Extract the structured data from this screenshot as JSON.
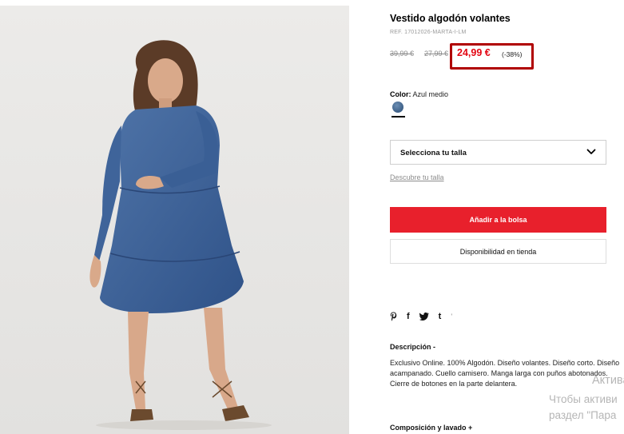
{
  "product": {
    "title": "Vestido algodón volantes",
    "ref": "REF. 17012026-MARTA-I-LM",
    "price_original": "39,99 €",
    "price_previous": "27,99 €",
    "price_current": "24,99 €",
    "discount": "(-38%)"
  },
  "color": {
    "label": "Color:",
    "value": "Azul medio",
    "swatch_color": "#4a6d96"
  },
  "size": {
    "select_label": "Selecciona tu talla",
    "guide_link": "Descubre tu talla"
  },
  "actions": {
    "add_to_bag": "Añadir a la bolsa",
    "store_availability": "Disponibilidad en tienda",
    "add_color": "#e8202c"
  },
  "social": {
    "pinterest": "P",
    "facebook": "f",
    "twitter": "twitter-icon",
    "tumblr": "t",
    "more": "'"
  },
  "description": {
    "title": "Descripción  -",
    "text": "Exclusivo Online. 100% Algodón. Diseño volantes. Diseño corto. Diseño acampanado. Cuello camisero. Manga larga con puños abotonados. Cierre de botones en la parte delantera."
  },
  "composition": {
    "title": "Composición y lavado  +"
  },
  "watermark": {
    "line1": "Активация",
    "line2": "Чтобы активи",
    "line3": "раздел \"Пара"
  },
  "image": {
    "subject": "model-in-denim-dress",
    "accent_price_color": "#e30613",
    "highlight_border_color": "#b00000"
  }
}
